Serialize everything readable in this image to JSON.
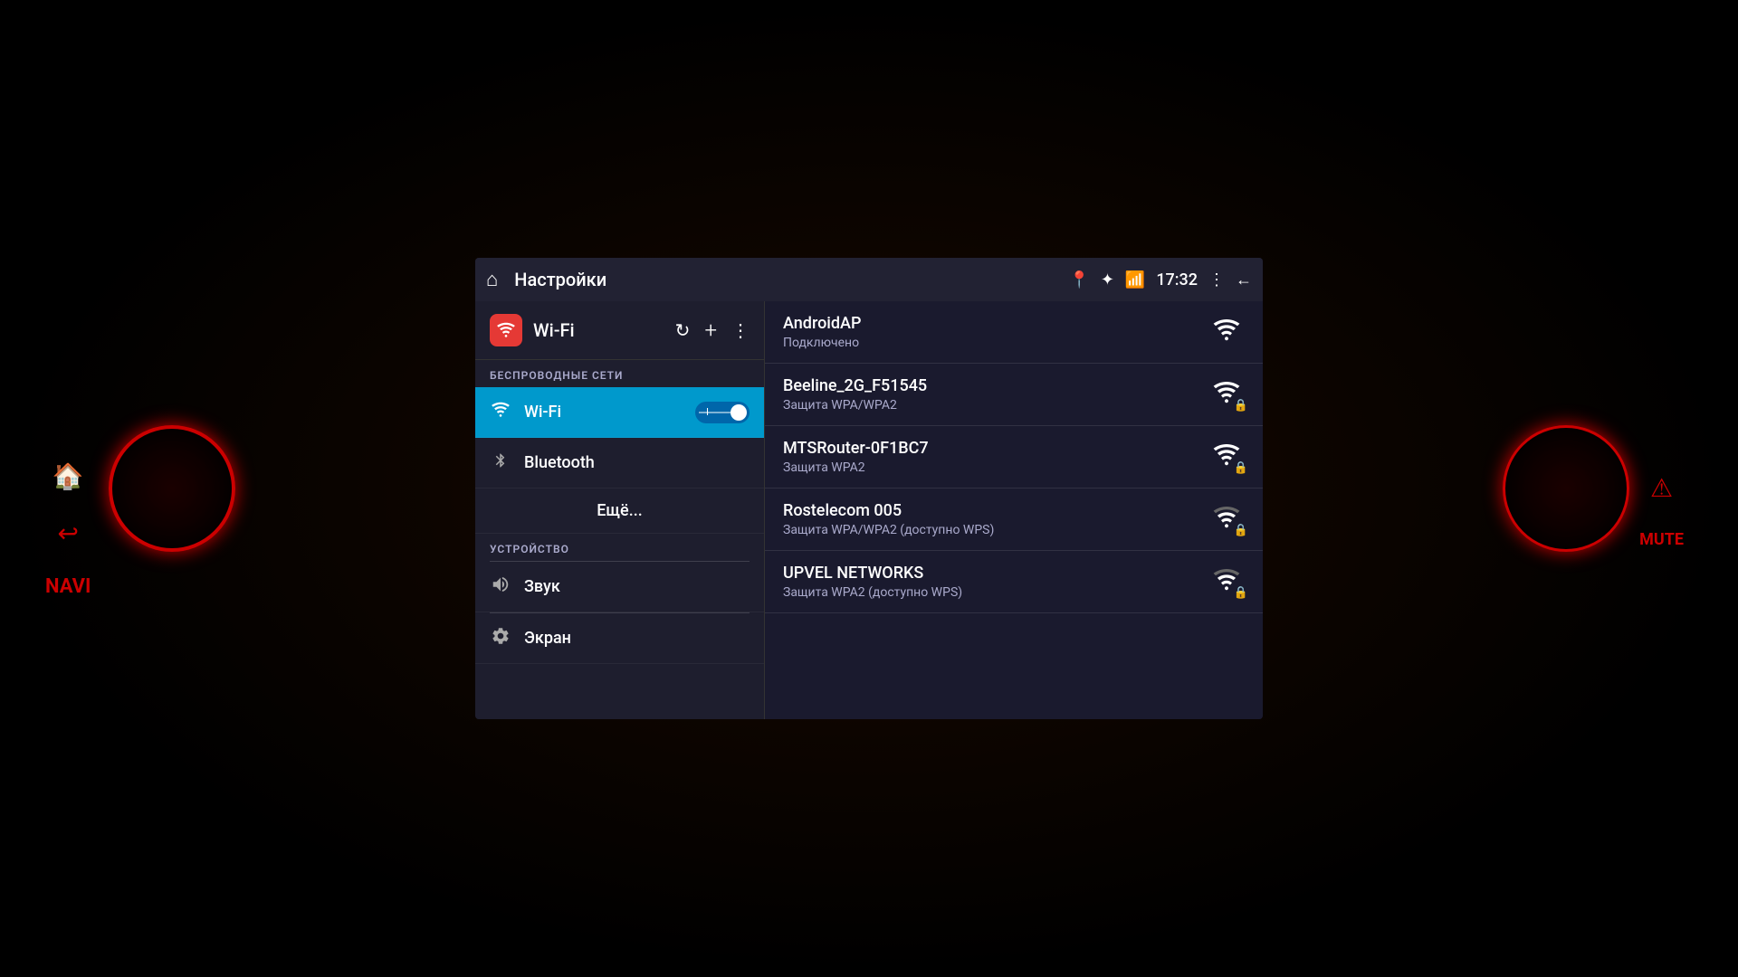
{
  "dashboard": {
    "background_color": "#000000"
  },
  "top_bar": {
    "title": "Настройки",
    "time": "17:32",
    "home_icon": "⌂",
    "location_icon": "📍",
    "bluetooth_icon": "⚡",
    "wifi_icon": "📶",
    "menu_icon": "⋮",
    "back_icon": "←"
  },
  "wifi_section": {
    "icon_label": "Wi-Fi",
    "refresh_icon": "↻",
    "add_icon": "+",
    "more_icon": "⋮"
  },
  "sidebar": {
    "wireless_section_label": "БЕСПРОВОДНЫЕ СЕТИ",
    "items": [
      {
        "id": "wifi",
        "icon": "📶",
        "label": "Wi-Fi",
        "active": true,
        "toggle": true,
        "toggle_state": "on"
      },
      {
        "id": "bluetooth",
        "icon": "⚡",
        "label": "Bluetooth",
        "active": false,
        "toggle": false
      },
      {
        "id": "more",
        "icon": "",
        "label": "Ещё...",
        "active": false,
        "is_more": true
      }
    ],
    "device_section_label": "УСТРОЙСТВО",
    "device_items": [
      {
        "id": "sound",
        "icon": "🔊",
        "label": "Звук"
      },
      {
        "id": "screen",
        "icon": "⚙",
        "label": "Экран"
      }
    ]
  },
  "networks": [
    {
      "name": "AndroidAP",
      "status": "Подключено",
      "signal": "full",
      "locked": false,
      "connected": true
    },
    {
      "name": "Beeline_2G_F51545",
      "status": "Защита WPA/WPA2",
      "signal": "medium",
      "locked": true,
      "connected": false
    },
    {
      "name": "MTSRouter-0F1BC7",
      "status": "Защита WPA2",
      "signal": "medium",
      "locked": true,
      "connected": false
    },
    {
      "name": "Rostelecom 005",
      "status": "Защита WPA/WPA2 (доступно WPS)",
      "signal": "low",
      "locked": true,
      "connected": false
    },
    {
      "name": "UPVEL NETWORKS",
      "status": "Защита WPA2 (доступно WPS)",
      "signal": "low",
      "locked": true,
      "connected": false
    }
  ]
}
